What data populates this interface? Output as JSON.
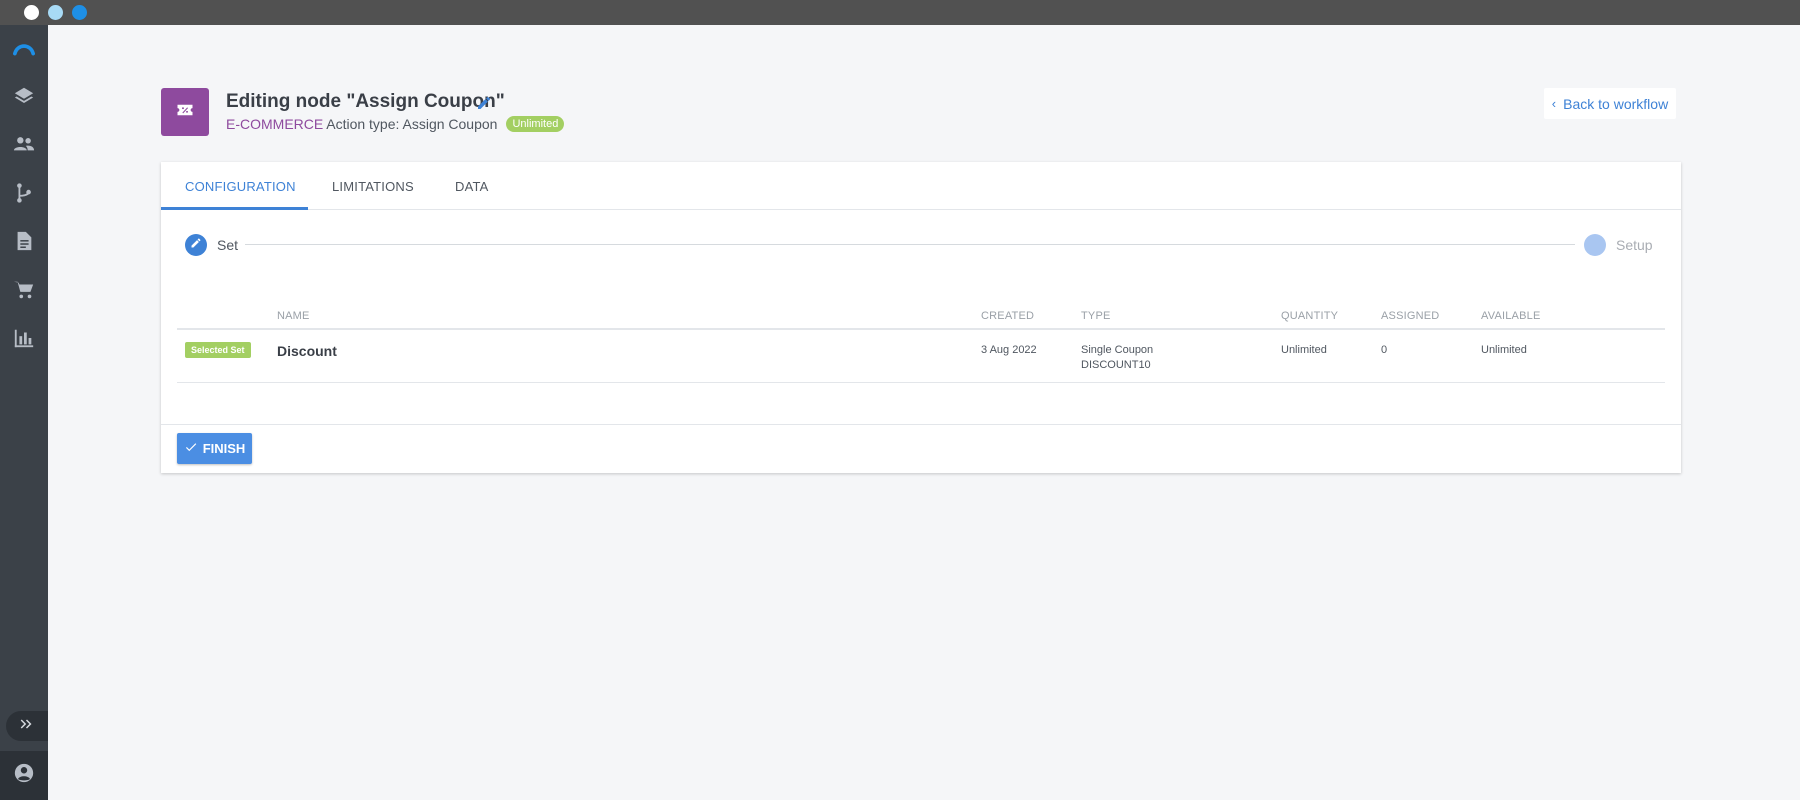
{
  "window": {
    "controls": [
      {
        "name": "close",
        "color": "#ffffff"
      },
      {
        "name": "minimize",
        "color": "#a8daf5"
      },
      {
        "name": "maximize",
        "color": "#1e8fe6"
      }
    ]
  },
  "sidebar": {
    "items": [
      {
        "icon": "logo-arc-icon"
      },
      {
        "icon": "layers-icon"
      },
      {
        "icon": "people-icon"
      },
      {
        "icon": "workflow-branch-icon"
      },
      {
        "icon": "document-icon"
      },
      {
        "icon": "cart-icon"
      },
      {
        "icon": "bar-chart-icon"
      }
    ],
    "expand_icon": "double-chevron-right-icon",
    "account_icon": "account-circle-icon"
  },
  "header": {
    "title": "Editing node \"Assign Coupon\"",
    "category": "E-COMMERCE",
    "action_type": "Action type: Assign Coupon",
    "badge": "Unlimited",
    "back_label": "Back to workflow"
  },
  "tabs": [
    {
      "label": "CONFIGURATION",
      "active": true
    },
    {
      "label": "LIMITATIONS",
      "active": false
    },
    {
      "label": "DATA",
      "active": false
    }
  ],
  "stepper": {
    "steps": [
      {
        "label": "Set",
        "state": "current"
      },
      {
        "label": "Setup",
        "state": "pending"
      }
    ]
  },
  "table": {
    "headers": [
      "NAME",
      "CREATED",
      "TYPE",
      "QUANTITY",
      "ASSIGNED",
      "AVAILABLE"
    ],
    "rows": [
      {
        "badge": "Selected Set",
        "name": "Discount",
        "created": "3 Aug 2022",
        "type": "Single Coupon",
        "code": "DISCOUNT10",
        "quantity": "Unlimited",
        "assigned": "0",
        "available": "Unlimited"
      }
    ]
  },
  "footer": {
    "finish_label": "FINISH"
  },
  "colors": {
    "accent": "#3e82d6",
    "node_purple": "#8e4a9e",
    "badge_green": "#a3cf62",
    "sidebar": "#3b4148"
  }
}
